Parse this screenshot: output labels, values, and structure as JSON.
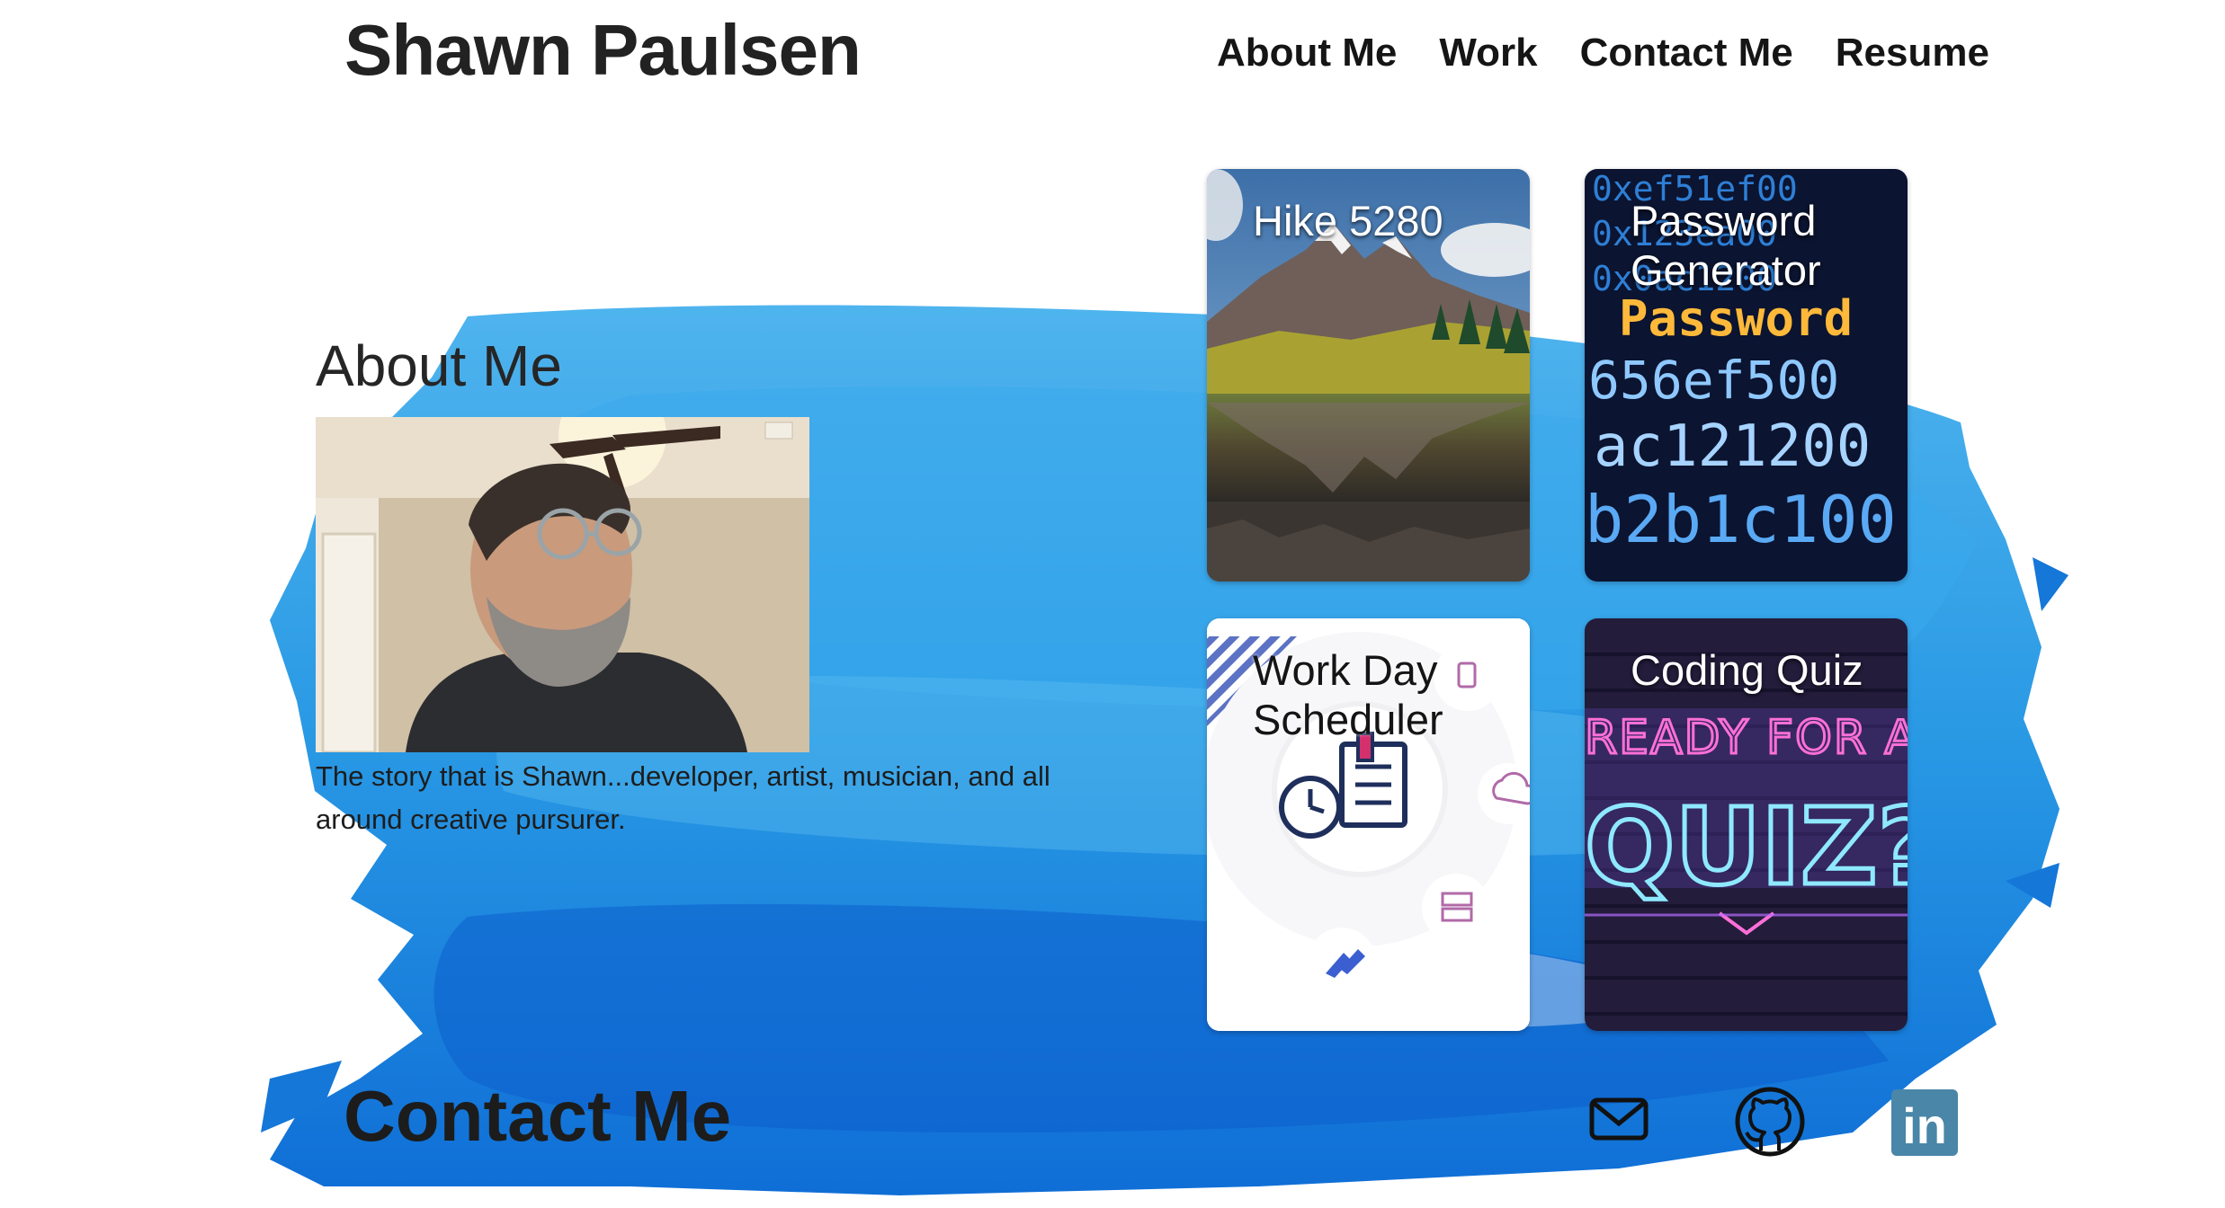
{
  "header": {
    "site_title": "Shawn Paulsen",
    "nav": [
      {
        "label": "About Me"
      },
      {
        "label": "Work"
      },
      {
        "label": "Contact Me"
      },
      {
        "label": "Resume"
      }
    ]
  },
  "about": {
    "heading": "About Me",
    "photo_icon": "profile-photo",
    "description": "The story that is Shawn...developer, artist, musician, and all around creative pursurer."
  },
  "work": {
    "cards": [
      {
        "title": "Hike 5280",
        "icon": "mountain-lake-image"
      },
      {
        "title": "Password Generator",
        "icon": "neon-password-image"
      },
      {
        "title": "Work Day Scheduler",
        "icon": "scheduler-illustration"
      },
      {
        "title": "Coding Quiz",
        "icon": "neon-quiz-image"
      }
    ],
    "password_image_lines": [
      "0xef51ef00",
      "0x123ea00",
      "0x0ac1200",
      "Password",
      "656ef500",
      "ac121200",
      "b2b1c100"
    ],
    "quiz_image_lines": [
      "READY FOR A",
      "QUIZ?"
    ]
  },
  "contact": {
    "heading": "Contact Me",
    "icons": [
      "mail-icon",
      "github-icon",
      "linkedin-icon"
    ],
    "linkedin_text": "in"
  },
  "colors": {
    "brush_blue": "#2b9be6",
    "brush_deep": "#0d63cf",
    "linkedin": "#4a86a8",
    "text": "#1f1f1f"
  }
}
